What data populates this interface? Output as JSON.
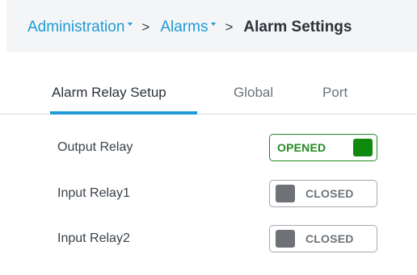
{
  "breadcrumb": {
    "items": [
      {
        "label": "Administration",
        "has_dropdown": true
      },
      {
        "label": "Alarms",
        "has_dropdown": true
      }
    ],
    "separator": ">",
    "current": "Alarm Settings"
  },
  "tabs": [
    {
      "label": "Alarm Relay Setup",
      "active": true
    },
    {
      "label": "Global",
      "active": false
    },
    {
      "label": "Port",
      "active": false
    }
  ],
  "relays": [
    {
      "label": "Output Relay",
      "state": "OPENED",
      "on": true
    },
    {
      "label": "Input Relay1",
      "state": "CLOSED",
      "on": false
    },
    {
      "label": "Input Relay2",
      "state": "CLOSED",
      "on": false
    }
  ],
  "colors": {
    "accent": "#1e9bd7",
    "opened": "#0f8a0f",
    "closed_knob": "#6e7175"
  }
}
